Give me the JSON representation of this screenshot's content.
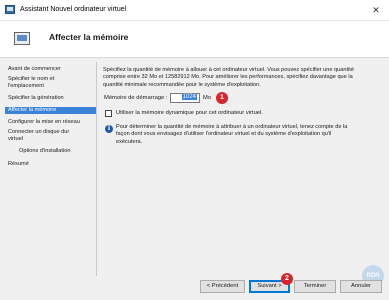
{
  "window": {
    "title": "Assistant Nouvel ordinateur virtuel",
    "close_glyph": "✕"
  },
  "header": {
    "title": "Affecter la mémoire"
  },
  "sidebar": {
    "items": [
      {
        "label": "Avant de commencer"
      },
      {
        "label": "Spécifier le nom et"
      },
      {
        "label": "l'emplacement"
      },
      {
        "label": "Spécifier la génération"
      },
      {
        "label": "Affecter la mémoire"
      },
      {
        "label": "Configurer la mise en réseau"
      },
      {
        "label": "Connecter un disque dur"
      },
      {
        "label": "virtuel"
      },
      {
        "label": "Options d'installation"
      },
      {
        "label": "Résumé"
      }
    ]
  },
  "main": {
    "description_lines": [
      "Spécifiez la quantité de mémoire à allouer à cet ordinateur virtuel. Vous pouvez spécifier une quantité",
      "comprise entre 32 Mo et 12582912 Mo. Pour améliorer les performances, spécifiez davantage que la",
      "quantité minimale recommandée pour le système d'exploitation."
    ],
    "startup_memory_label": "Mémoire de démarrage :",
    "startup_memory_value": "1024",
    "startup_memory_unit": "Mo",
    "dynamic_memory_label": "Utiliser la mémoire dynamique pour cet ordinateur virtuel.",
    "dynamic_memory_checked": false,
    "info_lines": [
      "Pour déterminer la quantité de mémoire à attribuer à un ordinateur virtuel, tenez compte de la",
      "façon dont vous envisagez d'utiliser l'ordinateur virtuel et du système d'exploitation qu'il",
      "exécutera."
    ]
  },
  "badges": {
    "step1": "1",
    "step2": "2"
  },
  "buttons": {
    "previous": "< Précédent",
    "next": "Suivant >",
    "finish": "Terminer",
    "cancel": "Annuler"
  },
  "watermark": {
    "text": "RDR"
  },
  "colors": {
    "accent": "#3b82d9",
    "badge": "#d7262b",
    "primary_border": "#0078d7"
  }
}
